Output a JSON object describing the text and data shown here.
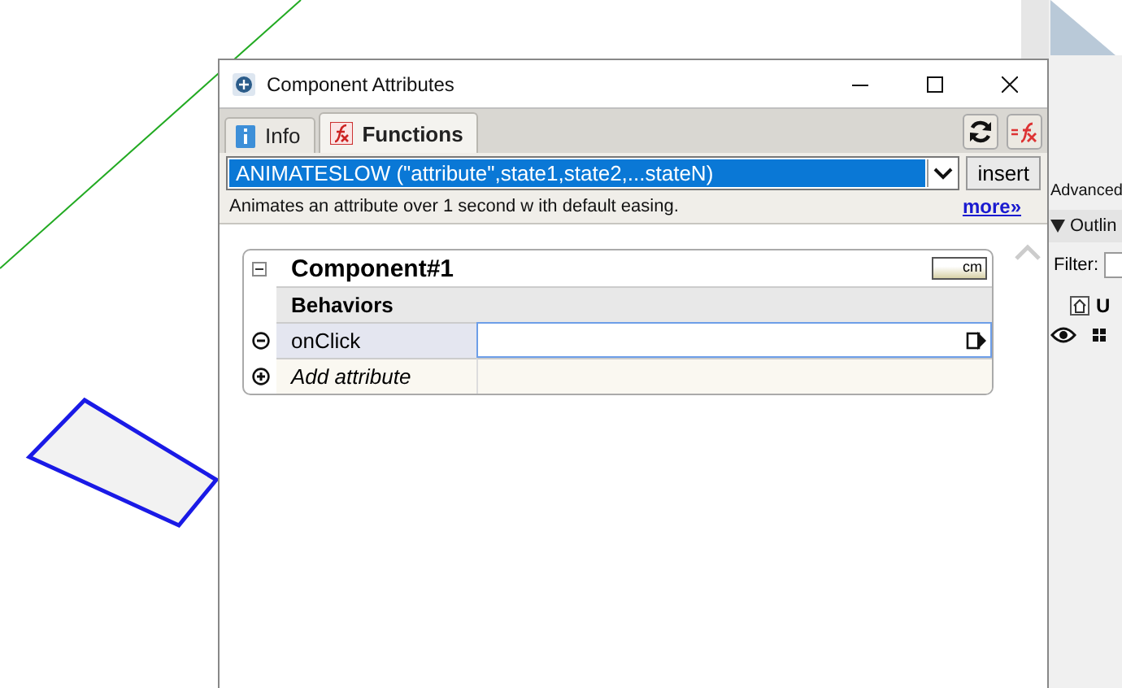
{
  "side_panel": {
    "advanced_label": "Advanced",
    "outliner": {
      "title": "Outlin",
      "expanded": true
    },
    "filter_label": "Filter:",
    "tree": [
      {
        "label": "U"
      }
    ]
  },
  "dialog": {
    "title": "Component Attributes",
    "tabs": [
      {
        "label": "Info",
        "selected": false,
        "kind": "info"
      },
      {
        "label": "Functions",
        "selected": true,
        "kind": "functions"
      }
    ],
    "function_select": {
      "value": "ANIMATESLOW (\"attribute\",state1,state2,...stateN)"
    },
    "insert_button": "insert",
    "description": "Animates an attribute over 1 second w ith default easing.",
    "more_link": "more»",
    "component": {
      "name": "Component#1",
      "expanded": true,
      "units": "cm",
      "section": "Behaviors",
      "attributes": [
        {
          "name": "onClick",
          "kind": "attribute"
        },
        {
          "name": "Add attribute",
          "kind": "add"
        }
      ]
    }
  }
}
